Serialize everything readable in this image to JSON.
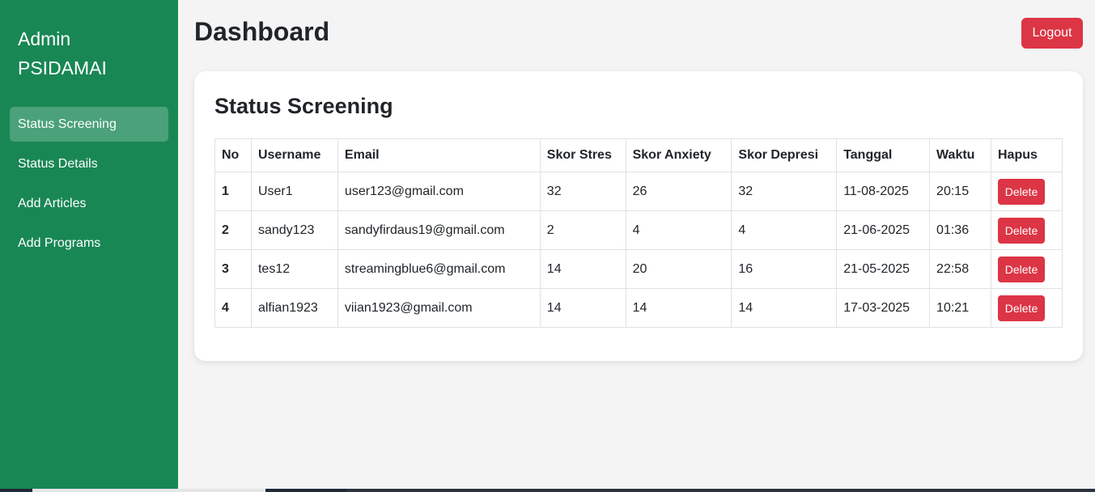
{
  "sidebar": {
    "brand_line1": "Admin",
    "brand_line2": "PSIDAMAI",
    "items": [
      {
        "label": "Status Screening"
      },
      {
        "label": "Status Details"
      },
      {
        "label": "Add Articles"
      },
      {
        "label": "Add Programs"
      }
    ]
  },
  "header": {
    "title": "Dashboard",
    "logout_label": "Logout"
  },
  "card": {
    "title": "Status Screening",
    "columns": [
      "No",
      "Username",
      "Email",
      "Skor Stres",
      "Skor Anxiety",
      "Skor Depresi",
      "Tanggal",
      "Waktu",
      "Hapus"
    ],
    "rows": [
      {
        "no": "1",
        "username": "User1",
        "email": "user123@gmail.com",
        "stres": "32",
        "anxiety": "26",
        "depresi": "32",
        "tanggal": "11-08-2025",
        "waktu": "20:15",
        "action": "Delete"
      },
      {
        "no": "2",
        "username": "sandy123",
        "email": "sandyfirdaus19@gmail.com",
        "stres": "2",
        "anxiety": "4",
        "depresi": "4",
        "tanggal": "21-06-2025",
        "waktu": "01:36",
        "action": "Delete"
      },
      {
        "no": "3",
        "username": "tes12",
        "email": "streamingblue6@gmail.com",
        "stres": "14",
        "anxiety": "20",
        "depresi": "16",
        "tanggal": "21-05-2025",
        "waktu": "22:58",
        "action": "Delete"
      },
      {
        "no": "4",
        "username": "alfian1923",
        "email": "viian1923@gmail.com",
        "stres": "14",
        "anxiety": "14",
        "depresi": "14",
        "tanggal": "17-03-2025",
        "waktu": "10:21",
        "action": "Delete"
      }
    ]
  },
  "colors": {
    "sidebar": "#198754",
    "danger": "#dc3545",
    "background": "#f4f4f4"
  }
}
